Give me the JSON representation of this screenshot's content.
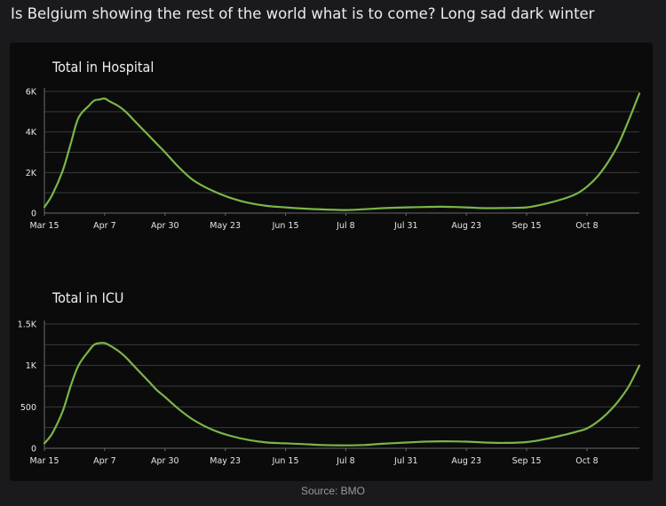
{
  "headline": "Is Belgium showing the rest of the world what is to come? Long sad dark winter",
  "source": "Source: BMO",
  "colors": {
    "background": "#1a1a1d",
    "panel": "#0b0b0c",
    "line": "#7ab648",
    "grid": "#3a3a3a",
    "text": "#e6e6e6"
  },
  "chart_data": [
    {
      "type": "line",
      "title": "Total in Hospital",
      "x_ticks": [
        "Mar 15",
        "Apr 7",
        "Apr 30",
        "May 23",
        "Jun 15",
        "Jul 8",
        "Jul 31",
        "Aug 23",
        "Sep 15",
        "Oct 8"
      ],
      "y_ticks": [
        "0",
        "2K",
        "4K",
        "6K"
      ],
      "ylim": [
        0,
        6000
      ],
      "grid": true,
      "series": [
        {
          "x": [
            "Mar 15",
            "Mar 18",
            "Mar 22",
            "Mar 25",
            "Mar 28",
            "Apr 1",
            "Apr 3",
            "Apr 5",
            "Apr 7",
            "Apr 9",
            "Apr 12",
            "Apr 15",
            "Apr 18",
            "Apr 21",
            "Apr 24",
            "Apr 27",
            "Apr 30",
            "May 5",
            "May 10",
            "May 15",
            "May 20",
            "May 25",
            "Jun 1",
            "Jun 8",
            "Jun 15",
            "Jun 22",
            "Jun 29",
            "Jul 8",
            "Jul 15",
            "Jul 22",
            "Jul 31",
            "Aug 7",
            "Aug 14",
            "Aug 23",
            "Aug 30",
            "Sep 7",
            "Sep 15",
            "Sep 22",
            "Sep 29",
            "Oct 4",
            "Oct 8",
            "Oct 12",
            "Oct 16",
            "Oct 20",
            "Oct 24",
            "Oct 28"
          ],
          "values": [
            300,
            900,
            2100,
            3400,
            4700,
            5300,
            5550,
            5600,
            5650,
            5500,
            5300,
            5000,
            4600,
            4200,
            3800,
            3400,
            3000,
            2300,
            1700,
            1300,
            1000,
            750,
            500,
            350,
            280,
            220,
            180,
            150,
            190,
            240,
            280,
            300,
            310,
            280,
            240,
            250,
            280,
            450,
            700,
            950,
            1300,
            1800,
            2500,
            3400,
            4600,
            5900
          ]
        }
      ]
    },
    {
      "type": "line",
      "title": "Total in ICU",
      "x_ticks": [
        "Mar 15",
        "Apr 7",
        "Apr 30",
        "May 23",
        "Jun 15",
        "Jul 8",
        "Jul 31",
        "Aug 23",
        "Sep 15",
        "Oct 8"
      ],
      "y_ticks": [
        "0",
        "500",
        "1K",
        "1.5K"
      ],
      "ylim": [
        0,
        1500
      ],
      "grid": true,
      "series": [
        {
          "x": [
            "Mar 15",
            "Mar 18",
            "Mar 22",
            "Mar 25",
            "Mar 28",
            "Apr 1",
            "Apr 3",
            "Apr 5",
            "Apr 7",
            "Apr 9",
            "Apr 12",
            "Apr 15",
            "Apr 18",
            "Apr 21",
            "Apr 24",
            "Apr 27",
            "Apr 30",
            "May 5",
            "May 10",
            "May 15",
            "May 20",
            "May 25",
            "Jun 1",
            "Jun 8",
            "Jun 15",
            "Jun 22",
            "Jun 29",
            "Jul 8",
            "Jul 15",
            "Jul 22",
            "Jul 31",
            "Aug 7",
            "Aug 14",
            "Aug 23",
            "Aug 30",
            "Sep 7",
            "Sep 15",
            "Sep 22",
            "Sep 29",
            "Oct 4",
            "Oct 8",
            "Oct 12",
            "Oct 16",
            "Oct 20",
            "Oct 24",
            "Oct 28"
          ],
          "values": [
            60,
            180,
            450,
            750,
            1000,
            1180,
            1250,
            1270,
            1270,
            1240,
            1180,
            1100,
            1000,
            900,
            800,
            700,
            620,
            480,
            360,
            270,
            200,
            150,
            100,
            70,
            60,
            50,
            40,
            35,
            40,
            55,
            70,
            80,
            85,
            80,
            70,
            65,
            75,
            110,
            160,
            200,
            240,
            320,
            430,
            570,
            750,
            1000
          ]
        }
      ]
    }
  ]
}
